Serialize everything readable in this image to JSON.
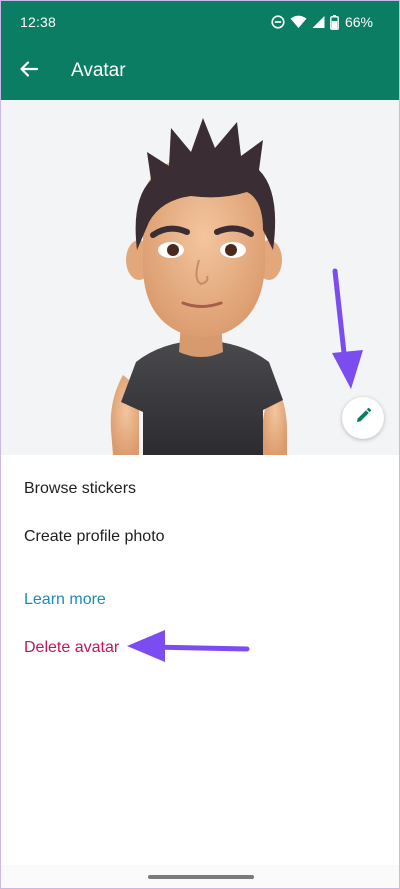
{
  "status_bar": {
    "time": "12:38",
    "battery": "66%",
    "icons": [
      "dnd-icon",
      "wifi-icon",
      "signal-icon",
      "battery-icon"
    ]
  },
  "app_bar": {
    "title": "Avatar",
    "back_icon": "arrow-left-icon"
  },
  "avatar": {
    "edit_icon": "pencil-icon"
  },
  "options": {
    "browse_stickers": "Browse stickers",
    "create_profile_photo": "Create profile photo",
    "learn_more": "Learn more",
    "delete_avatar": "Delete avatar"
  },
  "colors": {
    "app_bar": "#0b7d62",
    "link": "#1f8bb5",
    "danger": "#c2185b",
    "annotation": "#7b4cf0"
  }
}
